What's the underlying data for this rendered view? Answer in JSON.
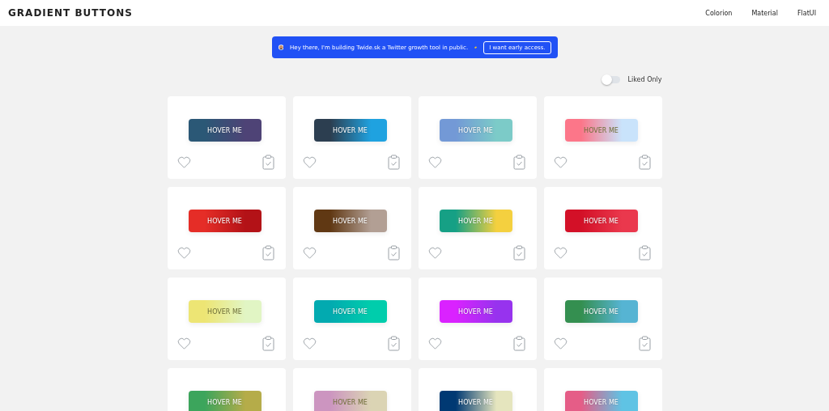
{
  "header": {
    "title": "GRADIENT BUTTONS",
    "nav": [
      "Colorion",
      "Material",
      "FlatUI"
    ]
  },
  "banner": {
    "text": "Hey there, I'm building Twide.sk a Twitter growth tool in public.",
    "button": "I want early access."
  },
  "filter": {
    "label": "Liked Only",
    "on": false
  },
  "cards": [
    {
      "label": "HOVER ME",
      "gradient": [
        {
          "color": "#2b5876"
        },
        {
          "color": "#4e4376"
        }
      ],
      "liked": false
    },
    {
      "label": "HOVER ME",
      "gradient": [
        {
          "color": "#2c3e50"
        },
        {
          "color": "#1fa2e0"
        }
      ],
      "liked": false
    },
    {
      "label": "HOVER ME",
      "gradient": [
        {
          "color": "#7399d6"
        },
        {
          "color": "#7ccbc8"
        }
      ],
      "liked": false
    },
    {
      "label": "HOVER ME",
      "gradient": [
        {
          "color": "#fc7689"
        },
        {
          "color": "#c9e3fb"
        }
      ],
      "liked": false
    },
    {
      "label": "HOVER ME",
      "gradient": [
        {
          "color": "#e52d27"
        },
        {
          "color": "#b31217"
        }
      ],
      "liked": false
    },
    {
      "label": "HOVER ME",
      "gradient": [
        {
          "color": "#603813"
        },
        {
          "color": "#b29f94"
        }
      ],
      "liked": false
    },
    {
      "label": "HOVER ME",
      "gradient": [
        {
          "color": "#16a085"
        },
        {
          "color": "#f4d03f"
        }
      ],
      "liked": false
    },
    {
      "label": "HOVER ME",
      "gradient": [
        {
          "color": "#d31027"
        },
        {
          "color": "#ea384d"
        }
      ],
      "liked": false
    },
    {
      "label": "HOVER ME",
      "gradient": [
        {
          "color": "#ede574"
        },
        {
          "color": "#e1f5c4"
        }
      ],
      "liked": false
    },
    {
      "label": "HOVER ME",
      "gradient": [
        {
          "color": "#02aab0"
        },
        {
          "color": "#00cdac"
        }
      ],
      "liked": false
    },
    {
      "label": "HOVER ME",
      "gradient": [
        {
          "color": "#da22ff"
        },
        {
          "color": "#9733ee"
        }
      ],
      "liked": false
    },
    {
      "label": "HOVER ME",
      "gradient": [
        {
          "color": "#348f50"
        },
        {
          "color": "#56b4d3"
        }
      ],
      "liked": false
    },
    {
      "label": "HOVER ME",
      "gradient": [
        {
          "color": "#3ca55c"
        },
        {
          "color": "#b5ac49"
        }
      ]
    },
    {
      "label": "HOVER ME",
      "gradient": [
        {
          "color": "#cc95c0"
        },
        {
          "color": "#dbd4b4"
        }
      ]
    },
    {
      "label": "HOVER ME",
      "gradient": [
        {
          "color": "#003973"
        },
        {
          "color": "#e5e5be"
        }
      ]
    },
    {
      "label": "HOVER ME",
      "gradient": [
        {
          "color": "#e55d87"
        },
        {
          "color": "#5fc3e4"
        }
      ]
    }
  ]
}
